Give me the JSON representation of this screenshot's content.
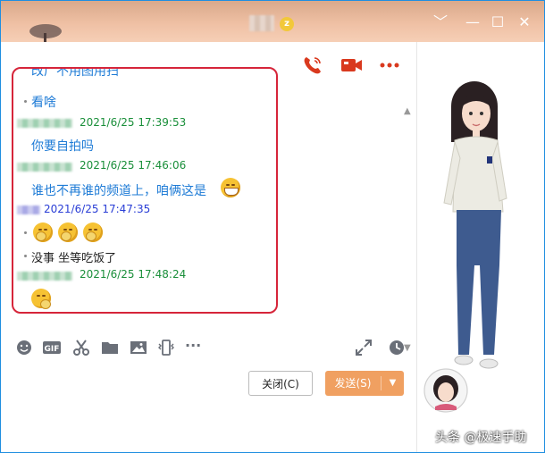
{
  "window": {
    "title_badge": "z",
    "controls": {
      "menu": "﹀",
      "minimize": "—",
      "maximize": "☐",
      "close": "✕"
    }
  },
  "header_actions": [
    "phone-call-icon",
    "video-call-icon",
    "more-icon"
  ],
  "messages": {
    "cut_text": "改广不用图用扫",
    "msg1": "看啥",
    "time2": "2021/6/25 17:39:53",
    "msg2": "你要自拍吗",
    "time3": "2021/6/25 17:46:06",
    "msg3": "谁也不再谁的频道上，咱俩这是",
    "time4": "2021/6/25 17:47:35",
    "msg5": "没事 坐等吃饭了",
    "time5": "2021/6/25 17:48:24"
  },
  "toolbar": {
    "gif_label": "GIF",
    "more_label": "···",
    "icons": [
      "emoji-icon",
      "gif-icon",
      "scissors-icon",
      "folder-icon",
      "image-icon",
      "shake-icon",
      "more-icon",
      "expand-icon",
      "history-icon"
    ]
  },
  "buttons": {
    "close_label": "关闭(C)",
    "send_label": "发送(S)",
    "send_arrow": "▼"
  },
  "watermark": "头条 @极速手助",
  "colors": {
    "accent_orange": "#f0a061",
    "action_red": "#d9391e",
    "highlight_box": "#d6253a",
    "link_blue": "#1e7bd6",
    "time_green": "#1a8f3a"
  }
}
